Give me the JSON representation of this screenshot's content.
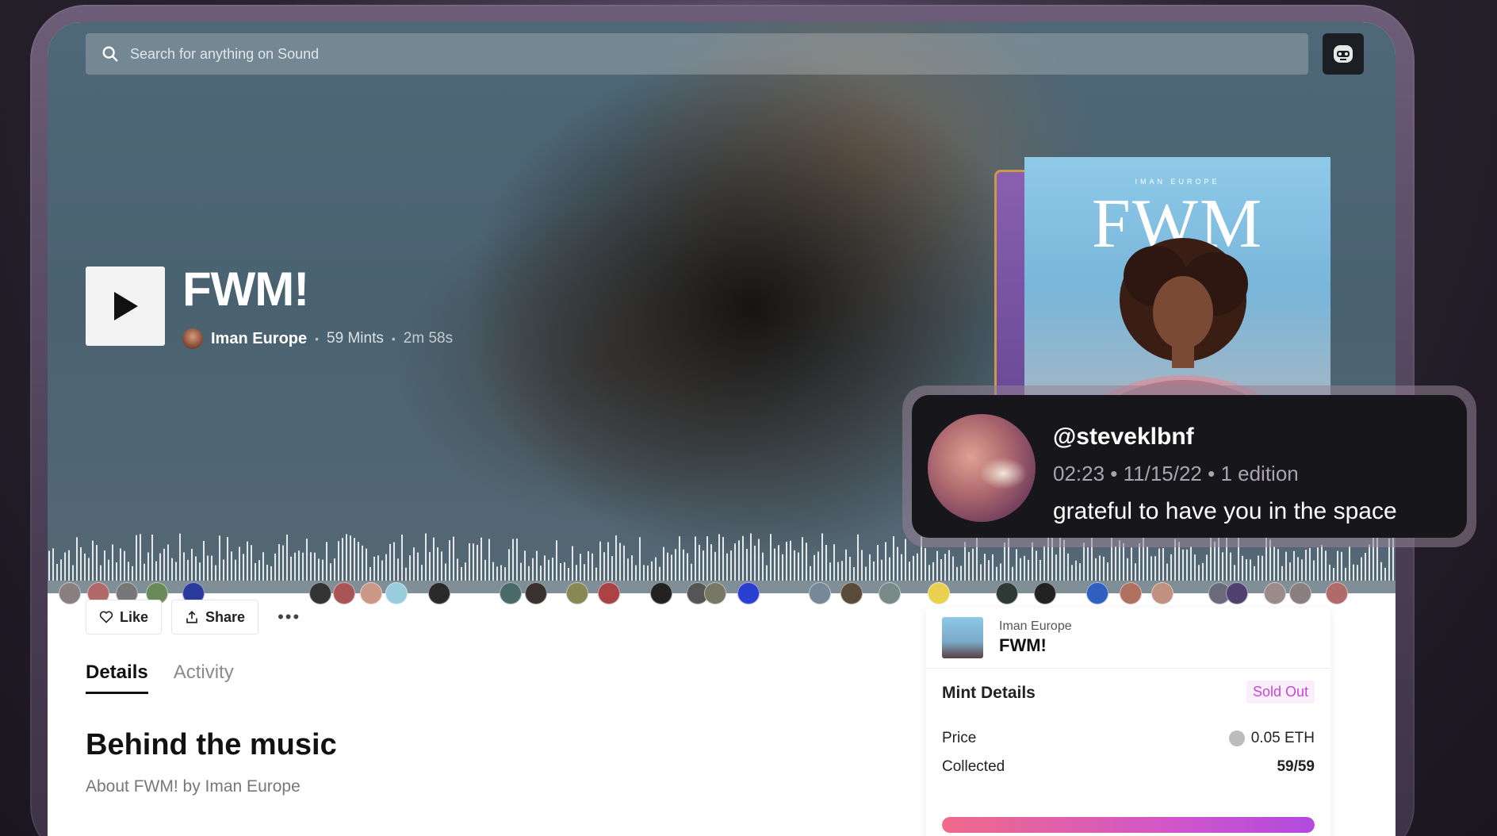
{
  "search": {
    "placeholder": "Search for anything on Sound"
  },
  "track": {
    "title": "FWM!",
    "artist": "Iman Europe",
    "mints": "59 Mints",
    "duration": "2m 58s"
  },
  "cover": {
    "artist_small": "IMAN EUROPE",
    "title_big": "FWM"
  },
  "comment": {
    "handle": "@steveklbnf",
    "meta": "02:23 • 11/15/22 • 1 edition",
    "text": "grateful to have you in the space"
  },
  "actions": {
    "like": "Like",
    "share": "Share",
    "more": "•••"
  },
  "tabs": [
    {
      "label": "Details",
      "active": true
    },
    {
      "label": "Activity",
      "active": false
    }
  ],
  "section": {
    "title": "Behind the music",
    "subtitle": "About FWM! by Iman Europe"
  },
  "mint": {
    "artist": "Iman Europe",
    "track": "FWM!",
    "details_label": "Mint Details",
    "status": "Sold Out",
    "price_label": "Price",
    "price_value": "0.05 ETH",
    "collected_label": "Collected",
    "collected_value": "59/59",
    "collected_fraction": 1.0
  },
  "colors": {
    "accent_pink": "#f06a8a",
    "accent_purple": "#b04ae0",
    "sold_out": "#c24bd0"
  },
  "icons": [
    "search-icon",
    "play-icon",
    "heart-icon",
    "share-icon",
    "more-icon",
    "eth-icon",
    "profile-avatar-icon"
  ]
}
